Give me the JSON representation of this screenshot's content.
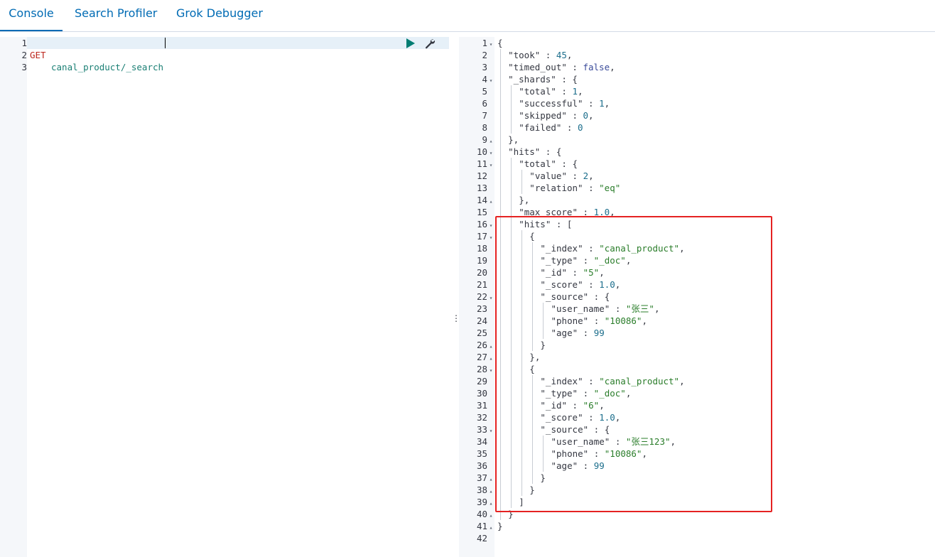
{
  "tabs": [
    {
      "label": "Console",
      "active": true
    },
    {
      "label": "Search Profiler",
      "active": false
    },
    {
      "label": "Grok Debugger",
      "active": false
    }
  ],
  "request": {
    "lines": [
      {
        "n": "1",
        "method": "GET",
        "url": "canal_product/_search"
      },
      {
        "n": "2"
      },
      {
        "n": "3"
      }
    ],
    "actions": {
      "run_icon": "play-icon",
      "settings_icon": "wrench-icon"
    }
  },
  "response": {
    "lines": [
      {
        "n": "1",
        "fold": "open",
        "indent": 0,
        "tokens": [
          [
            "p",
            "{"
          ]
        ]
      },
      {
        "n": "2",
        "indent": 1,
        "tokens": [
          [
            "k",
            "\"took\""
          ],
          [
            "p",
            " : "
          ],
          [
            "n",
            "45"
          ],
          [
            "p",
            ","
          ]
        ]
      },
      {
        "n": "3",
        "indent": 1,
        "tokens": [
          [
            "k",
            "\"timed_out\""
          ],
          [
            "p",
            " : "
          ],
          [
            "b",
            "false"
          ],
          [
            "p",
            ","
          ]
        ]
      },
      {
        "n": "4",
        "fold": "open",
        "indent": 1,
        "tokens": [
          [
            "k",
            "\"_shards\""
          ],
          [
            "p",
            " : {"
          ]
        ]
      },
      {
        "n": "5",
        "indent": 2,
        "tokens": [
          [
            "k",
            "\"total\""
          ],
          [
            "p",
            " : "
          ],
          [
            "n",
            "1"
          ],
          [
            "p",
            ","
          ]
        ]
      },
      {
        "n": "6",
        "indent": 2,
        "tokens": [
          [
            "k",
            "\"successful\""
          ],
          [
            "p",
            " : "
          ],
          [
            "n",
            "1"
          ],
          [
            "p",
            ","
          ]
        ]
      },
      {
        "n": "7",
        "indent": 2,
        "tokens": [
          [
            "k",
            "\"skipped\""
          ],
          [
            "p",
            " : "
          ],
          [
            "n",
            "0"
          ],
          [
            "p",
            ","
          ]
        ]
      },
      {
        "n": "8",
        "indent": 2,
        "tokens": [
          [
            "k",
            "\"failed\""
          ],
          [
            "p",
            " : "
          ],
          [
            "n",
            "0"
          ]
        ]
      },
      {
        "n": "9",
        "fold": "close",
        "indent": 1,
        "tokens": [
          [
            "p",
            "},"
          ]
        ]
      },
      {
        "n": "10",
        "fold": "open",
        "indent": 1,
        "tokens": [
          [
            "k",
            "\"hits\""
          ],
          [
            "p",
            " : {"
          ]
        ]
      },
      {
        "n": "11",
        "fold": "open",
        "indent": 2,
        "tokens": [
          [
            "k",
            "\"total\""
          ],
          [
            "p",
            " : {"
          ]
        ]
      },
      {
        "n": "12",
        "indent": 3,
        "tokens": [
          [
            "k",
            "\"value\""
          ],
          [
            "p",
            " : "
          ],
          [
            "n",
            "2"
          ],
          [
            "p",
            ","
          ]
        ]
      },
      {
        "n": "13",
        "indent": 3,
        "tokens": [
          [
            "k",
            "\"relation\""
          ],
          [
            "p",
            " : "
          ],
          [
            "s",
            "\"eq\""
          ]
        ]
      },
      {
        "n": "14",
        "fold": "close",
        "indent": 2,
        "tokens": [
          [
            "p",
            "},"
          ]
        ]
      },
      {
        "n": "15",
        "indent": 2,
        "tokens": [
          [
            "k",
            "\"max_score\""
          ],
          [
            "p",
            " : "
          ],
          [
            "n",
            "1.0"
          ],
          [
            "p",
            ","
          ]
        ]
      },
      {
        "n": "16",
        "fold": "open",
        "indent": 2,
        "tokens": [
          [
            "k",
            "\"hits\""
          ],
          [
            "p",
            " : ["
          ]
        ]
      },
      {
        "n": "17",
        "fold": "open",
        "indent": 3,
        "tokens": [
          [
            "p",
            "{"
          ]
        ]
      },
      {
        "n": "18",
        "indent": 4,
        "tokens": [
          [
            "k",
            "\"_index\""
          ],
          [
            "p",
            " : "
          ],
          [
            "s",
            "\"canal_product\""
          ],
          [
            "p",
            ","
          ]
        ]
      },
      {
        "n": "19",
        "indent": 4,
        "tokens": [
          [
            "k",
            "\"_type\""
          ],
          [
            "p",
            " : "
          ],
          [
            "s",
            "\"_doc\""
          ],
          [
            "p",
            ","
          ]
        ]
      },
      {
        "n": "20",
        "indent": 4,
        "tokens": [
          [
            "k",
            "\"_id\""
          ],
          [
            "p",
            " : "
          ],
          [
            "s",
            "\"5\""
          ],
          [
            "p",
            ","
          ]
        ]
      },
      {
        "n": "21",
        "indent": 4,
        "tokens": [
          [
            "k",
            "\"_score\""
          ],
          [
            "p",
            " : "
          ],
          [
            "n",
            "1.0"
          ],
          [
            "p",
            ","
          ]
        ]
      },
      {
        "n": "22",
        "fold": "open",
        "indent": 4,
        "tokens": [
          [
            "k",
            "\"_source\""
          ],
          [
            "p",
            " : {"
          ]
        ]
      },
      {
        "n": "23",
        "indent": 5,
        "tokens": [
          [
            "k",
            "\"user_name\""
          ],
          [
            "p",
            " : "
          ],
          [
            "s",
            "\"张三\""
          ],
          [
            "p",
            ","
          ]
        ]
      },
      {
        "n": "24",
        "indent": 5,
        "tokens": [
          [
            "k",
            "\"phone\""
          ],
          [
            "p",
            " : "
          ],
          [
            "s",
            "\"10086\""
          ],
          [
            "p",
            ","
          ]
        ]
      },
      {
        "n": "25",
        "indent": 5,
        "tokens": [
          [
            "k",
            "\"age\""
          ],
          [
            "p",
            " : "
          ],
          [
            "n",
            "99"
          ]
        ]
      },
      {
        "n": "26",
        "fold": "close",
        "indent": 4,
        "tokens": [
          [
            "p",
            "}"
          ]
        ]
      },
      {
        "n": "27",
        "fold": "close",
        "indent": 3,
        "tokens": [
          [
            "p",
            "},"
          ]
        ]
      },
      {
        "n": "28",
        "fold": "open",
        "indent": 3,
        "tokens": [
          [
            "p",
            "{"
          ]
        ]
      },
      {
        "n": "29",
        "indent": 4,
        "tokens": [
          [
            "k",
            "\"_index\""
          ],
          [
            "p",
            " : "
          ],
          [
            "s",
            "\"canal_product\""
          ],
          [
            "p",
            ","
          ]
        ]
      },
      {
        "n": "30",
        "indent": 4,
        "tokens": [
          [
            "k",
            "\"_type\""
          ],
          [
            "p",
            " : "
          ],
          [
            "s",
            "\"_doc\""
          ],
          [
            "p",
            ","
          ]
        ]
      },
      {
        "n": "31",
        "indent": 4,
        "tokens": [
          [
            "k",
            "\"_id\""
          ],
          [
            "p",
            " : "
          ],
          [
            "s",
            "\"6\""
          ],
          [
            "p",
            ","
          ]
        ]
      },
      {
        "n": "32",
        "indent": 4,
        "tokens": [
          [
            "k",
            "\"_score\""
          ],
          [
            "p",
            " : "
          ],
          [
            "n",
            "1.0"
          ],
          [
            "p",
            ","
          ]
        ]
      },
      {
        "n": "33",
        "fold": "open",
        "indent": 4,
        "tokens": [
          [
            "k",
            "\"_source\""
          ],
          [
            "p",
            " : {"
          ]
        ]
      },
      {
        "n": "34",
        "indent": 5,
        "tokens": [
          [
            "k",
            "\"user_name\""
          ],
          [
            "p",
            " : "
          ],
          [
            "s",
            "\"张三123\""
          ],
          [
            "p",
            ","
          ]
        ]
      },
      {
        "n": "35",
        "indent": 5,
        "tokens": [
          [
            "k",
            "\"phone\""
          ],
          [
            "p",
            " : "
          ],
          [
            "s",
            "\"10086\""
          ],
          [
            "p",
            ","
          ]
        ]
      },
      {
        "n": "36",
        "indent": 5,
        "tokens": [
          [
            "k",
            "\"age\""
          ],
          [
            "p",
            " : "
          ],
          [
            "n",
            "99"
          ]
        ]
      },
      {
        "n": "37",
        "fold": "close",
        "indent": 4,
        "tokens": [
          [
            "p",
            "}"
          ]
        ]
      },
      {
        "n": "38",
        "fold": "close",
        "indent": 3,
        "tokens": [
          [
            "p",
            "}"
          ]
        ]
      },
      {
        "n": "39",
        "fold": "close",
        "indent": 2,
        "tokens": [
          [
            "p",
            "]"
          ]
        ]
      },
      {
        "n": "40",
        "fold": "close",
        "indent": 1,
        "tokens": [
          [
            "p",
            "}"
          ]
        ]
      },
      {
        "n": "41",
        "fold": "close",
        "indent": 0,
        "tokens": [
          [
            "p",
            "}"
          ]
        ]
      },
      {
        "n": "42",
        "indent": 0,
        "tokens": []
      }
    ]
  },
  "highlight": {
    "color": "#e52222",
    "from_line": "16",
    "to_line": "39"
  },
  "colors": {
    "accent": "#006bb4",
    "run": "#017d73",
    "method": "#bd271e",
    "string": "#2a7d2a",
    "number": "#1c6e8c"
  }
}
